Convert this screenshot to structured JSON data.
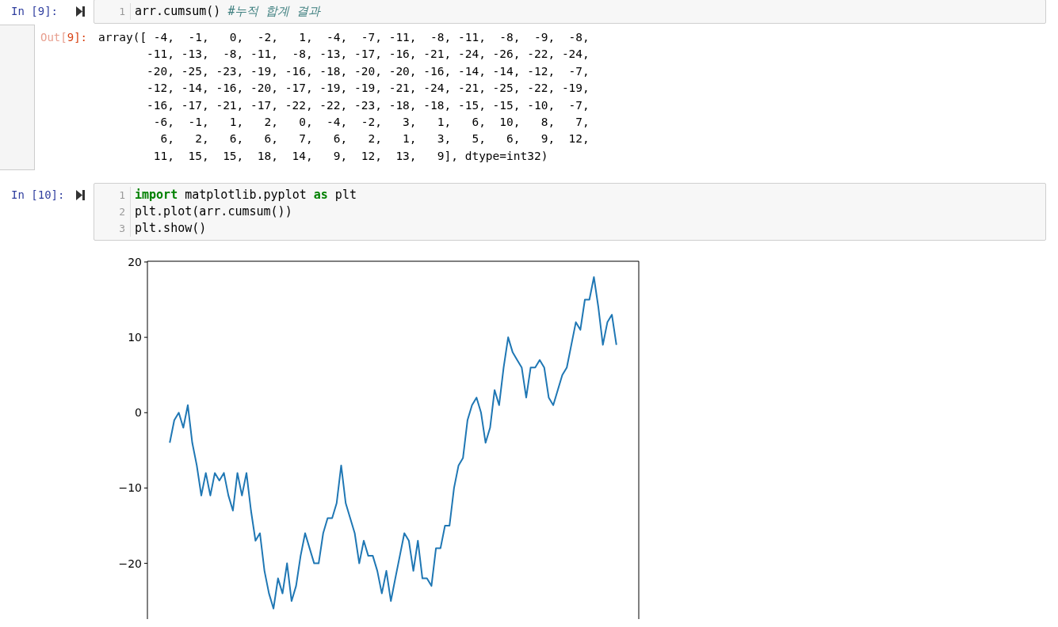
{
  "cells": [
    {
      "prompt": "In [9]:",
      "code": [
        {
          "number": "1",
          "tokens": [
            {
              "kind": "plain",
              "text": "arr.cumsum() "
            },
            {
              "kind": "comment",
              "text": "#누적 합계 결과"
            }
          ]
        }
      ],
      "output": {
        "prompt_label": "Out[",
        "prompt_number": "9]:",
        "lines": [
          "array([ -4,  -1,   0,  -2,   1,  -4,  -7, -11,  -8, -11,  -8,  -9,  -8,",
          "       -11, -13,  -8, -11,  -8, -13, -17, -16, -21, -24, -26, -22, -24,",
          "       -20, -25, -23, -19, -16, -18, -20, -20, -16, -14, -14, -12,  -7,",
          "       -12, -14, -16, -20, -17, -19, -19, -21, -24, -21, -25, -22, -19,",
          "       -16, -17, -21, -17, -22, -22, -23, -18, -18, -15, -15, -10,  -7,",
          "        -6,  -1,   1,   2,   0,  -4,  -2,   3,   1,   6,  10,   8,   7,",
          "         6,   2,   6,   6,   7,   6,   2,   1,   3,   5,   6,   9,  12,",
          "        11,  15,  15,  18,  14,   9,  12,  13,   9], dtype=int32)"
        ]
      }
    },
    {
      "prompt": "In [10]:",
      "code": [
        {
          "number": "1",
          "tokens": [
            {
              "kind": "keyword",
              "text": "import"
            },
            {
              "kind": "plain",
              "text": " matplotlib.pyplot "
            },
            {
              "kind": "keyword",
              "text": "as"
            },
            {
              "kind": "plain",
              "text": " plt"
            }
          ]
        },
        {
          "number": "2",
          "tokens": [
            {
              "kind": "plain",
              "text": "plt.plot(arr.cumsum())"
            }
          ]
        },
        {
          "number": "3",
          "tokens": [
            {
              "kind": "plain",
              "text": "plt.show()"
            }
          ]
        }
      ],
      "chart_data": {
        "type": "line",
        "ylim": [
          -27.4,
          20.1
        ],
        "yticks": [
          -20,
          -10,
          0,
          10,
          20
        ],
        "series": [
          {
            "color": "#1f77b4",
            "values": [
              -4,
              -1,
              0,
              -2,
              1,
              -4,
              -7,
              -11,
              -8,
              -11,
              -8,
              -9,
              -8,
              -11,
              -13,
              -8,
              -11,
              -8,
              -13,
              -17,
              -16,
              -21,
              -24,
              -26,
              -22,
              -24,
              -20,
              -25,
              -23,
              -19,
              -16,
              -18,
              -20,
              -20,
              -16,
              -14,
              -14,
              -12,
              -7,
              -12,
              -14,
              -16,
              -20,
              -17,
              -19,
              -19,
              -21,
              -24,
              -21,
              -25,
              -22,
              -19,
              -16,
              -17,
              -21,
              -17,
              -22,
              -22,
              -23,
              -18,
              -18,
              -15,
              -15,
              -10,
              -7,
              -6,
              -1,
              1,
              2,
              0,
              -4,
              -2,
              3,
              1,
              6,
              10,
              8,
              7,
              6,
              2,
              6,
              6,
              7,
              6,
              2,
              1,
              3,
              5,
              6,
              9,
              12,
              11,
              15,
              15,
              18,
              14,
              9,
              12,
              13,
              9
            ]
          }
        ]
      }
    }
  ]
}
